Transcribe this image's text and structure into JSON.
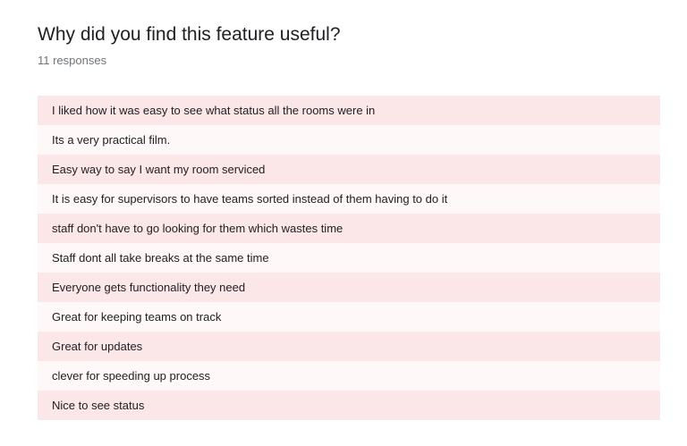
{
  "question": {
    "title": "Why did you find this feature useful?",
    "response_count": "11 responses"
  },
  "responses": [
    "I liked how it was easy to see what status all the rooms were in",
    "Its a very practical film.",
    "Easy way to say I want my room serviced",
    "It is easy for supervisors to have teams sorted instead of them having to do it",
    "staff don't have to go looking for them which wastes time",
    "Staff dont all take breaks at the same time",
    "Everyone gets functionality they need",
    "Great for keeping teams on track",
    "Great for updates",
    "clever for speeding up process",
    "Nice to see status"
  ],
  "colors": {
    "row_odd": "#fbe7e7",
    "row_even": "#fef8f8",
    "title_text": "#202124",
    "secondary_text": "#70757a"
  }
}
